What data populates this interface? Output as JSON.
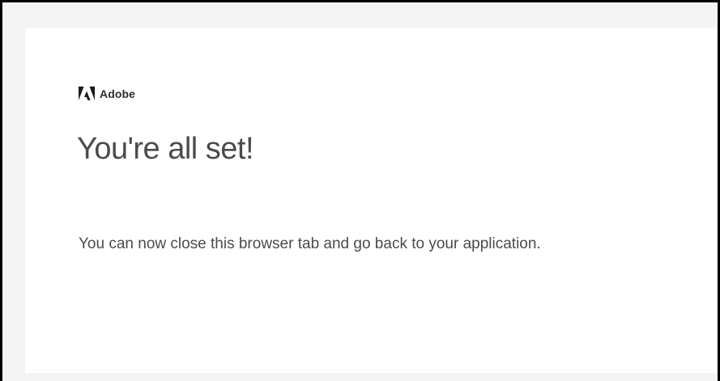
{
  "brand": {
    "logo_icon": "adobe-logo-icon",
    "name": "Adobe"
  },
  "page": {
    "headline": "You're all set!",
    "message": "You can now close this browser tab and go back to your application."
  },
  "colors": {
    "border": "#000000",
    "background": "#f4f4f4",
    "card": "#ffffff",
    "text": "#4b4b4b",
    "brand_text": "#2c2c2c"
  }
}
